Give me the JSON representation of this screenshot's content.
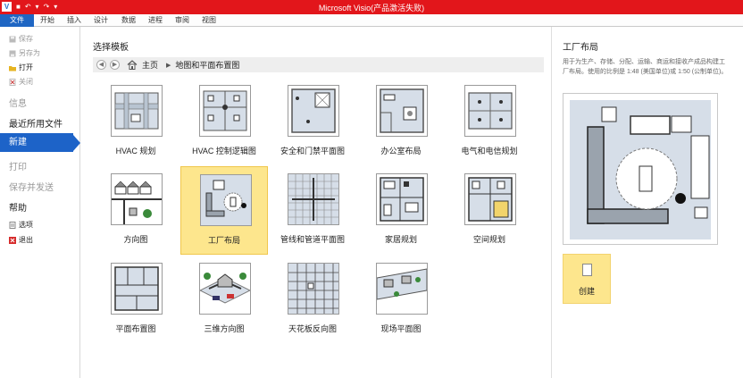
{
  "titlebar": {
    "title": "Microsoft Visio(产品激活失败)"
  },
  "tabs": [
    "文件",
    "开始",
    "插入",
    "设计",
    "数据",
    "进程",
    "审阅",
    "视图"
  ],
  "leftnav": {
    "save": "保存",
    "save_as": "另存为",
    "open": "打开",
    "close": "关闭",
    "info": "信息",
    "recent": "最近所用文件",
    "new": "新建",
    "print": "打印",
    "save_send": "保存并发送",
    "help": "帮助",
    "options": "选项",
    "exit": "退出"
  },
  "main": {
    "section_title": "选择模板",
    "breadcrumb": {
      "home": "主页",
      "current": "地图和平面布置图"
    },
    "templates": [
      "HVAC 规划",
      "HVAC 控制逻辑图",
      "安全和门禁平面图",
      "办公室布局",
      "电气和电信规划",
      "方向图",
      "工厂布局",
      "管线和管道平面图",
      "家居规划",
      "空间规划",
      "平面布置图",
      "三维方向图",
      "天花板反向图",
      "现场平面图"
    ]
  },
  "preview": {
    "title": "工厂布局",
    "description": "用于为生产、存储、分配、运输、商运和接收产成品构建工厂布局。使用的比例是 1:48 (美国单位)或 1:50 (公制单位)。",
    "create_label": "创建"
  }
}
